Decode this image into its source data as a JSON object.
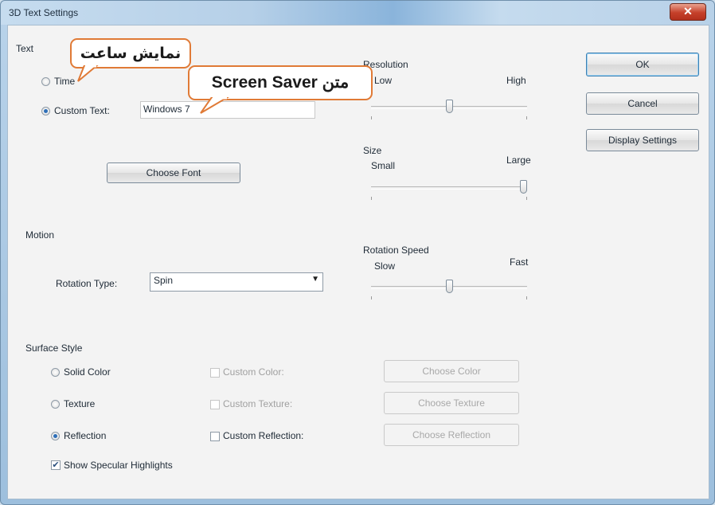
{
  "window": {
    "title": "3D Text Settings",
    "close_glyph": "✕"
  },
  "text_group": {
    "heading": "Text",
    "time_label": "Time",
    "custom_text_label": "Custom Text:",
    "custom_text_value": "Windows 7",
    "selected": "custom_text",
    "choose_font": "Choose Font"
  },
  "resolution": {
    "label": "Resolution",
    "min_label": "Low",
    "max_label": "High",
    "level": 0.5
  },
  "size": {
    "label": "Size",
    "min_label": "Small",
    "max_label": "Large",
    "level": 1.0
  },
  "motion": {
    "heading": "Motion",
    "rotation_type_label": "Rotation Type:",
    "rotation_type_value": "Spin",
    "rotation_speed_label": "Rotation Speed",
    "speed_min_label": "Slow",
    "speed_max_label": "Fast",
    "speed_level": 0.5
  },
  "surface_style": {
    "heading": "Surface Style",
    "options": [
      {
        "label": "Solid Color",
        "selected": false,
        "custom_label": "Custom Color:",
        "custom_enabled": false,
        "custom_checked": false,
        "button_label": "Choose Color",
        "button_enabled": false
      },
      {
        "label": "Texture",
        "selected": false,
        "custom_label": "Custom Texture:",
        "custom_enabled": false,
        "custom_checked": false,
        "button_label": "Choose Texture",
        "button_enabled": false
      },
      {
        "label": "Reflection",
        "selected": true,
        "custom_label": "Custom Reflection:",
        "custom_enabled": true,
        "custom_checked": false,
        "button_label": "Choose Reflection",
        "button_enabled": false
      }
    ],
    "specular_label": "Show Specular Highlights",
    "specular_checked": true
  },
  "buttons": {
    "ok": "OK",
    "cancel": "Cancel",
    "display_settings": "Display Settings"
  },
  "callouts": {
    "time_annotation": "نمایش ساعت",
    "custom_text_annotation": "متن Screen Saver"
  },
  "colors": {
    "callout_border": "#e07a36",
    "title_bar": "#b6d0e8",
    "close_button": "#c5402a"
  }
}
